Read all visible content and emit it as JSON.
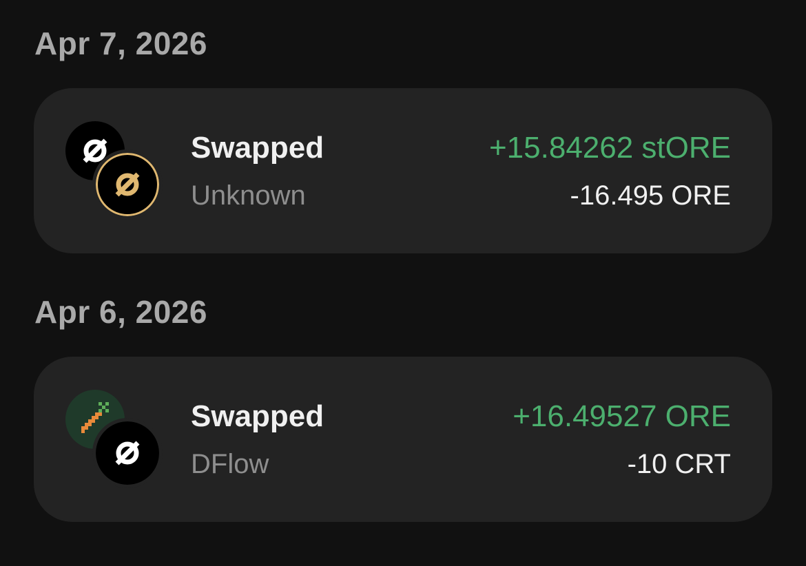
{
  "colors": {
    "background": "#111111",
    "card": "#232323",
    "positive": "#4caf6e",
    "date_text": "#a9a9a9",
    "subtitle_text": "#8e8e8e",
    "gold": "#e0b870"
  },
  "groups": [
    {
      "date": "Apr 7, 2026",
      "transaction": {
        "type": "Swapped",
        "source": "Unknown",
        "amount_in": "+15.84262 stORE",
        "amount_out": "-16.495 ORE",
        "icons": [
          "ore-token-icon",
          "store-token-icon"
        ]
      }
    },
    {
      "date": "Apr 6, 2026",
      "transaction": {
        "type": "Swapped",
        "source": "DFlow",
        "amount_in": "+16.49527 ORE",
        "amount_out": "-10 CRT",
        "icons": [
          "carrot-token-icon",
          "ore-token-icon"
        ]
      }
    }
  ]
}
